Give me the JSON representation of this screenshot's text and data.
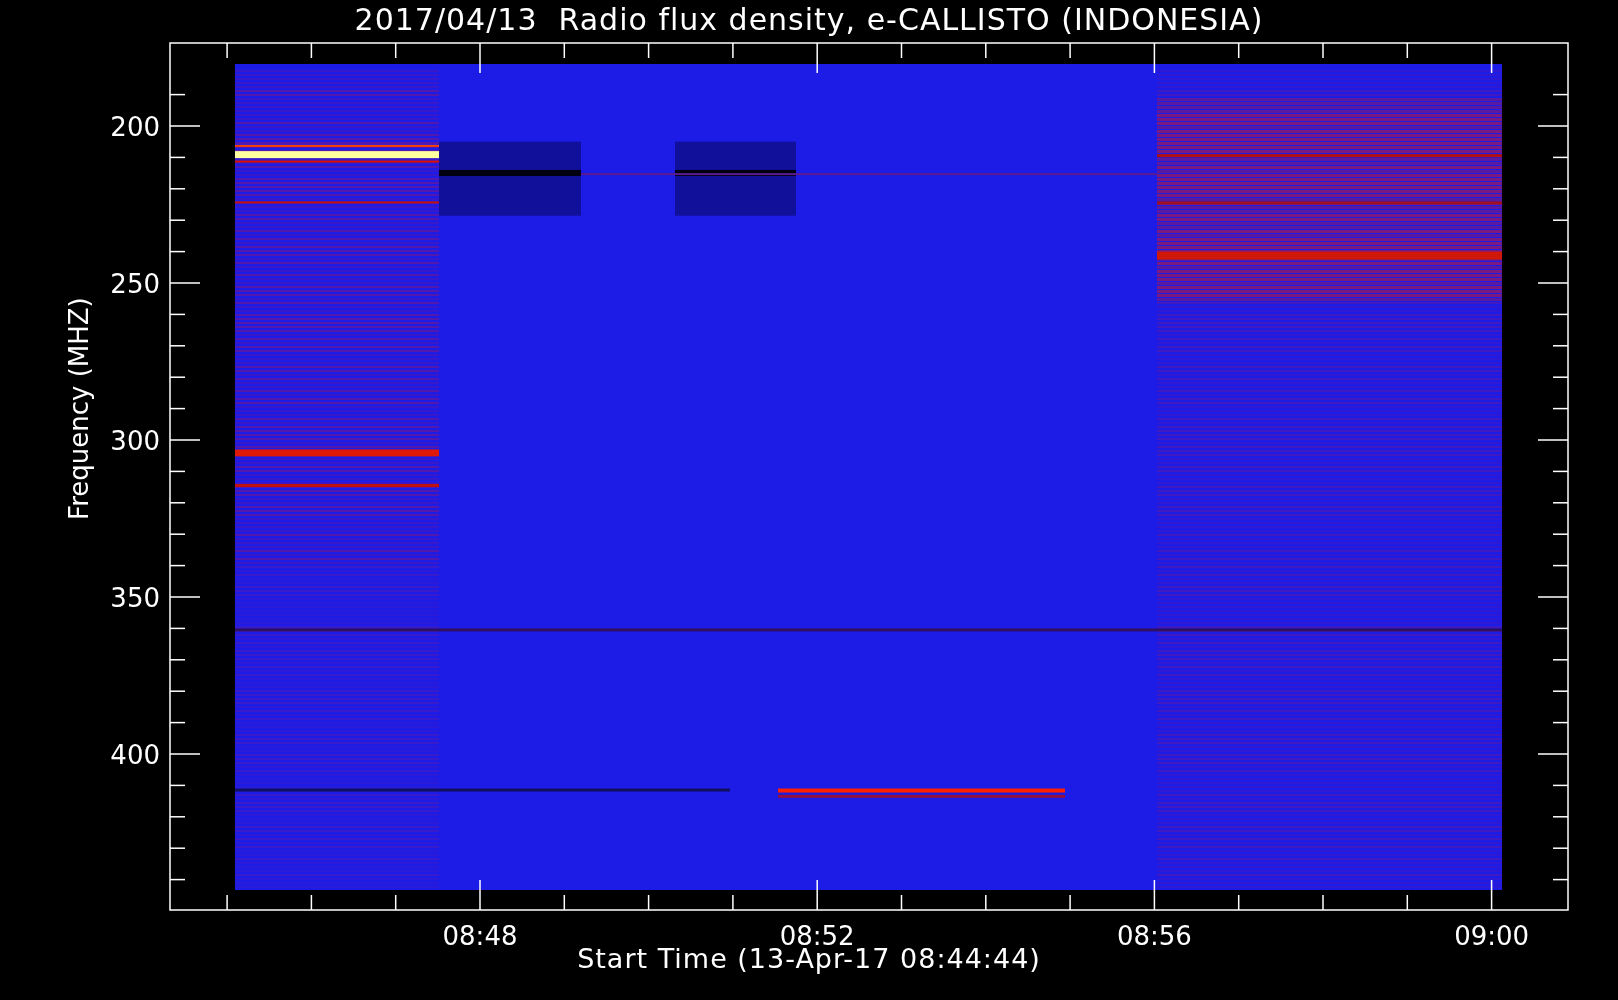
{
  "title": "2017/04/13  Radio flux density, e-CALLISTO (INDONESIA)",
  "y_axis": {
    "label": "Frequency (MHZ)",
    "ticks": [
      {
        "label": "200"
      },
      {
        "label": "250"
      },
      {
        "label": "300"
      },
      {
        "label": "350"
      },
      {
        "label": "400"
      }
    ]
  },
  "x_axis": {
    "label": "Start Time (13-Apr-17 08:44:44)",
    "ticks": [
      {
        "label": "08:48"
      },
      {
        "label": "08:52"
      },
      {
        "label": "08:56"
      },
      {
        "label": "09:00"
      }
    ]
  }
}
